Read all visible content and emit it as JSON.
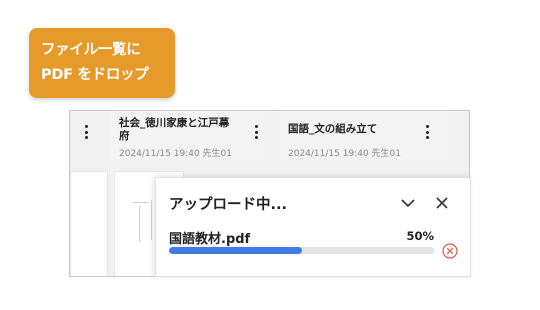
{
  "callout": {
    "line1": "ファイル一覧に",
    "line2": "PDF をドロップ"
  },
  "cards": [
    {
      "title_line1": "社会_徳川家康と江戸幕",
      "title_line2": "府",
      "meta": "2024/11/15 19:40 先生01"
    },
    {
      "title_line1": "国語_文の組み立て",
      "meta": "2024/11/15 19:40 先生01"
    }
  ],
  "upload": {
    "title": "アップロード中...",
    "file_name": "国語教材.pdf",
    "percent_label": "50%",
    "progress": 0.5,
    "colors": {
      "bar": "#3f7be0",
      "track": "#e3e3e3",
      "cancel": "#e05555"
    }
  },
  "icons": [
    "more-vert-icon",
    "chevron-down-icon",
    "close-icon",
    "cancel-circle-icon"
  ]
}
